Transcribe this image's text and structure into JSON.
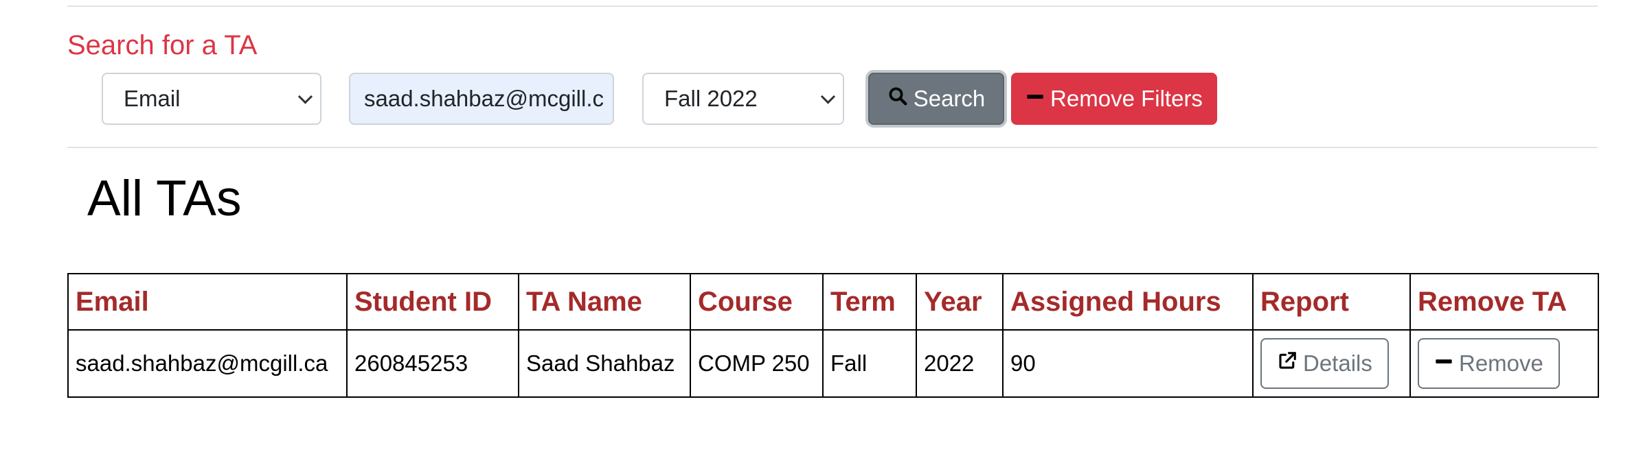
{
  "search": {
    "title": "Search for a TA",
    "filter_type": "Email",
    "query_value": "saad.shahbaz@mcgill.c",
    "term_value": "Fall 2022",
    "search_label": "Search",
    "remove_filters_label": "Remove Filters"
  },
  "page": {
    "title": "All TAs"
  },
  "table": {
    "headers": [
      "Email",
      "Student ID",
      "TA Name",
      "Course",
      "Term",
      "Year",
      "Assigned Hours",
      "Report",
      "Remove TA"
    ],
    "rows": [
      {
        "email": "saad.shahbaz@mcgill.ca",
        "student_id": "260845253",
        "ta_name": "Saad Shahbaz",
        "course": "COMP 250",
        "term": "Fall",
        "year": "2022",
        "assigned_hours": "90",
        "details_label": "Details",
        "remove_label": "Remove"
      }
    ]
  },
  "colors": {
    "accent_red": "#dc3545",
    "header_red": "#a52a2a",
    "secondary_gray": "#6c757d"
  },
  "icons": {
    "search": "search-icon",
    "minus": "minus-icon",
    "external_link": "external-link-icon"
  }
}
